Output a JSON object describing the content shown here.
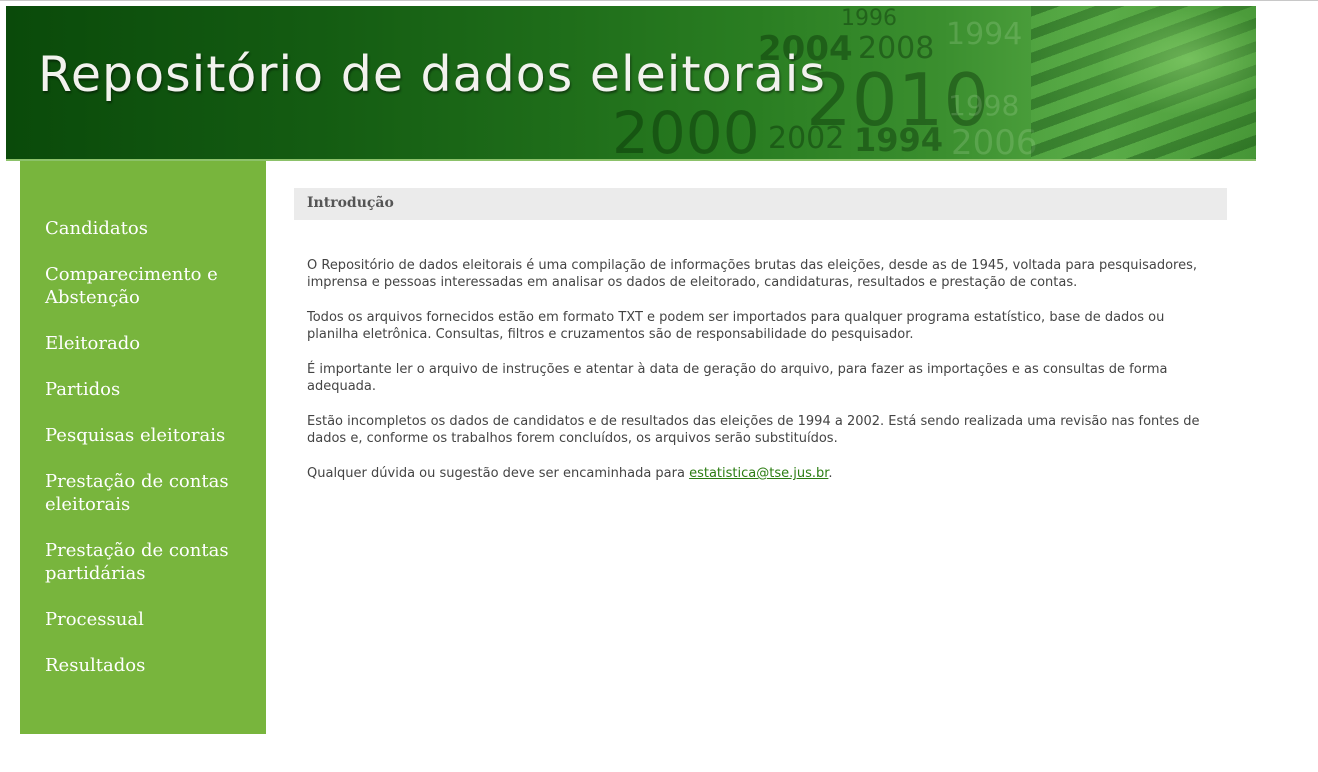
{
  "banner": {
    "title": "Repositório de dados eleitorais",
    "decorative_years": [
      "1996",
      "2004",
      "2008",
      "1994",
      "2010",
      "1998",
      "2000",
      "2002",
      "1994",
      "2006"
    ]
  },
  "sidebar": {
    "items": [
      {
        "label": "Candidatos"
      },
      {
        "label": "Comparecimento e Abstenção"
      },
      {
        "label": "Eleitorado"
      },
      {
        "label": "Partidos"
      },
      {
        "label": "Pesquisas eleitorais"
      },
      {
        "label": "Prestação de contas eleitorais"
      },
      {
        "label": "Prestação de contas partidárias"
      },
      {
        "label": "Processual"
      },
      {
        "label": "Resultados"
      }
    ]
  },
  "main": {
    "section_title": "Introdução",
    "paragraphs": [
      "O Repositório de dados eleitorais é uma compilação de informações brutas das eleições, desde as de 1945, voltada para pesquisadores, imprensa e pessoas interessadas em analisar os dados de eleitorado, candidaturas, resultados e prestação de contas.",
      "Todos os arquivos fornecidos estão em formato TXT e podem ser importados para qualquer programa estatístico, base de dados ou planilha eletrônica. Consultas, filtros e cruzamentos são de responsabilidade do pesquisador.",
      "É importante ler o arquivo de instruções e atentar à data de geração do arquivo, para fazer as importações e as consultas de forma adequada.",
      "Estão incompletos os dados de candidatos e de resultados das eleições de 1994 a 2002. Está sendo realizada uma revisão nas fontes de dados e, conforme os trabalhos forem concluídos, os arquivos serão substituídos."
    ],
    "contact_prefix": "Qualquer dúvida ou sugestão deve ser encaminhada para ",
    "contact_email": "estatistica@tse.jus.br",
    "contact_suffix": "."
  },
  "colors": {
    "banner_dark": "#0a4a0a",
    "banner_light": "#55a843",
    "sidebar_bg": "#78b53d",
    "header_bg": "#ebebeb",
    "link": "#2b7d12",
    "body_text": "#444444"
  }
}
